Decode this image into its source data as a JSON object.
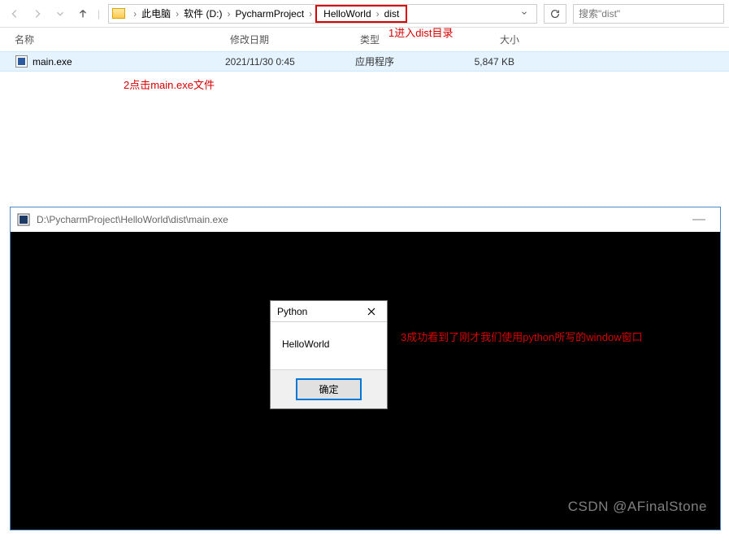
{
  "explorer": {
    "breadcrumbs": {
      "pc": "此电脑",
      "drive": "软件 (D:)",
      "project": "PycharmProject",
      "hello": "HelloWorld",
      "dist": "dist"
    },
    "search_placeholder": "搜索\"dist\"",
    "columns": {
      "name": "名称",
      "modified": "修改日期",
      "type": "类型",
      "size": "大小"
    },
    "files": [
      {
        "name": "main.exe",
        "modified": "2021/11/30 0:45",
        "type": "应用程序",
        "size": "5,847 KB"
      }
    ]
  },
  "annotations": {
    "a1": "1进入dist目录",
    "a2": "2点击main.exe文件",
    "a3": "3成功看到了刚才我们使用python所写的window窗口"
  },
  "console": {
    "title": "D:\\PycharmProject\\HelloWorld\\dist\\main.exe"
  },
  "dialog": {
    "title": "Python",
    "message": "HelloWorld",
    "ok": "确定"
  },
  "watermark": "CSDN @AFinalStone"
}
